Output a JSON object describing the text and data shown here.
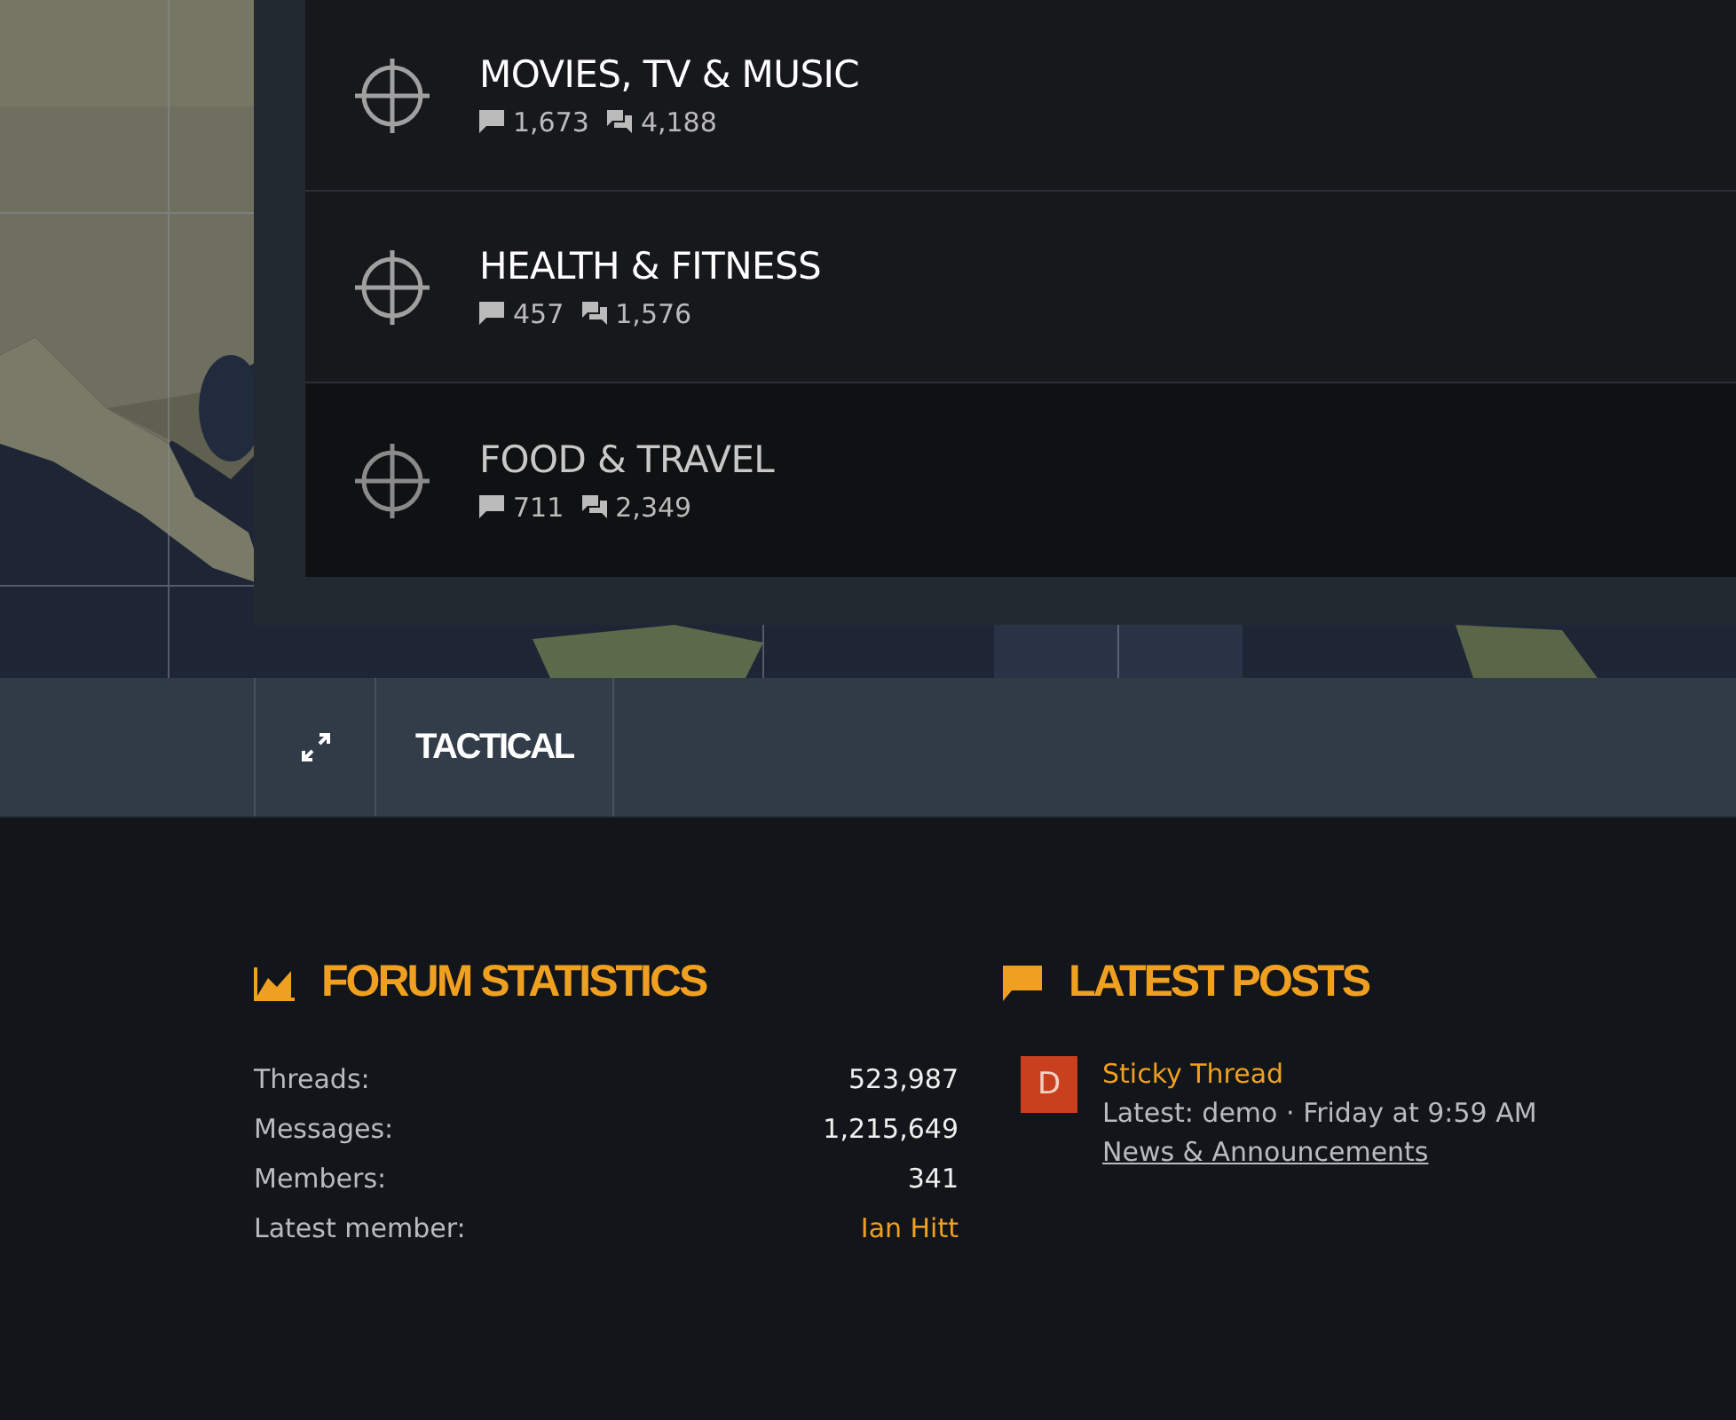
{
  "forums": [
    {
      "title": "MOVIES, TV & MUSIC",
      "threads": "1,673",
      "messages": "4,188",
      "read": false
    },
    {
      "title": "HEALTH & FITNESS",
      "threads": "457",
      "messages": "1,576",
      "read": false
    },
    {
      "title": "FOOD & TRAVEL",
      "threads": "711",
      "messages": "2,349",
      "read": true
    }
  ],
  "nav": {
    "items": [
      {
        "label": "TACTICAL",
        "selected": true
      }
    ]
  },
  "forum_statistics": {
    "title": "FORUM STATISTICS",
    "rows": [
      {
        "label": "Threads:",
        "value": "523,987",
        "kind": "plain"
      },
      {
        "label": "Messages:",
        "value": "1,215,649",
        "kind": "plain"
      },
      {
        "label": "Members:",
        "value": "341",
        "kind": "plain"
      },
      {
        "label": "Latest member:",
        "value": "Ian Hitt",
        "kind": "link"
      }
    ]
  },
  "latest_posts": {
    "title": "LATEST POSTS",
    "posts": [
      {
        "avatar": "D",
        "title": "Sticky Thread",
        "latest": "Latest: demo",
        "separator": "·",
        "time": "Friday at 9:59 AM",
        "forum": "News & Announcements"
      }
    ]
  }
}
